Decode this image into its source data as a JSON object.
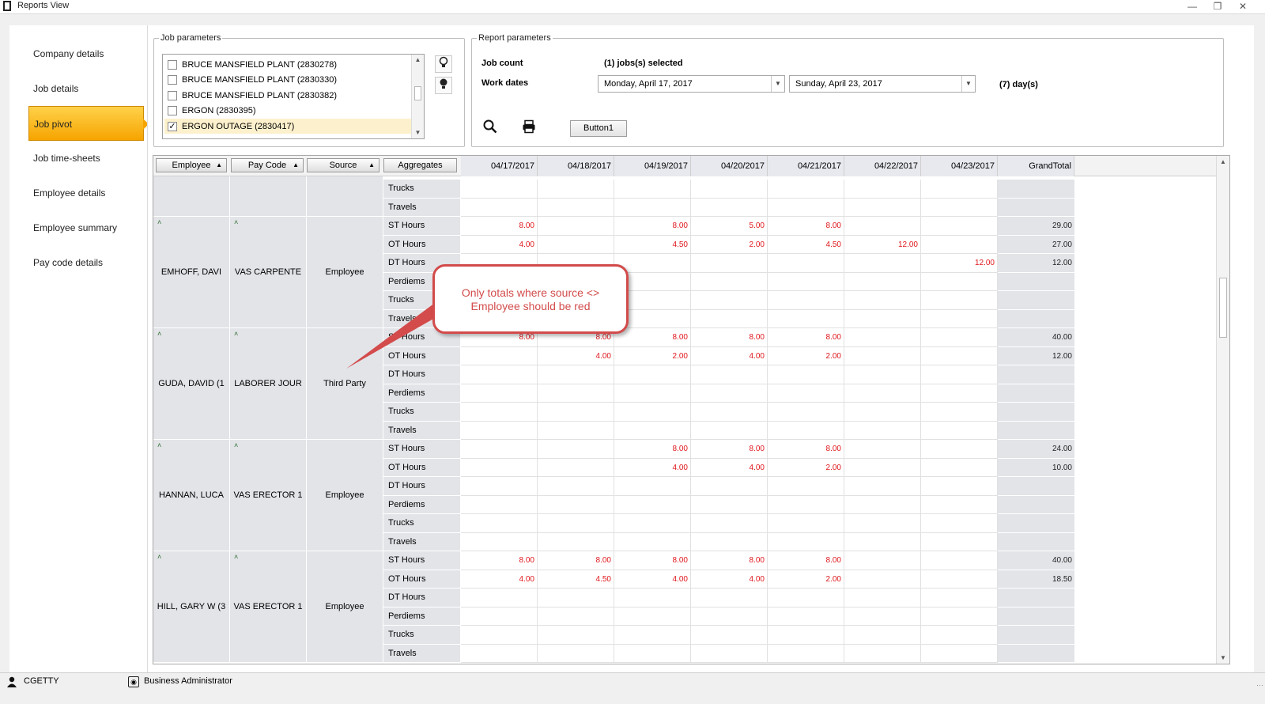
{
  "window": {
    "title": "Reports View"
  },
  "sidebar": {
    "items": [
      {
        "label": "Company details"
      },
      {
        "label": "Job details"
      },
      {
        "label": "Job pivot",
        "active": true
      },
      {
        "label": "Job time-sheets"
      },
      {
        "label": "Employee details"
      },
      {
        "label": "Employee summary"
      },
      {
        "label": "Pay code details"
      }
    ]
  },
  "job_parameters": {
    "legend": "Job parameters",
    "jobs": [
      {
        "label": "BRUCE MANSFIELD PLANT (2830278)",
        "checked": false
      },
      {
        "label": "BRUCE MANSFIELD PLANT (2830330)",
        "checked": false
      },
      {
        "label": "BRUCE MANSFIELD PLANT (2830382)",
        "checked": false
      },
      {
        "label": "ERGON (2830395)",
        "checked": false
      },
      {
        "label": "ERGON OUTAGE (2830417)",
        "checked": true
      }
    ]
  },
  "report_parameters": {
    "legend": "Report parameters",
    "job_count_label": "Job count",
    "job_count_value": "(1) jobs(s) selected",
    "work_dates_label": "Work dates",
    "start_date": "Monday, April 17, 2017",
    "end_date": "Sunday, April 23, 2017",
    "days": "(7) day(s)",
    "button1_label": "Button1"
  },
  "pivot": {
    "field_buttons": [
      "Employee",
      "Pay Code",
      "Source",
      "Aggregates"
    ],
    "dates": [
      "04/17/2017",
      "04/18/2017",
      "04/19/2017",
      "04/20/2017",
      "04/21/2017",
      "04/22/2017",
      "04/23/2017"
    ],
    "grand_total_label": "GrandTotal",
    "partial_rows": [
      {
        "agg": "Trucks",
        "total": ""
      },
      {
        "agg": "Travels",
        "total": ""
      }
    ],
    "groups": [
      {
        "employee": "EMHOFF, DAVI",
        "pay_code": "VAS CARPENTE",
        "source": "Employee",
        "rows": [
          {
            "agg": "ST Hours",
            "values": [
              "8.00",
              "",
              "8.00",
              "5.00",
              "8.00",
              "",
              ""
            ],
            "total": "29.00"
          },
          {
            "agg": "OT Hours",
            "values": [
              "4.00",
              "",
              "4.50",
              "2.00",
              "4.50",
              "12.00",
              ""
            ],
            "total": "27.00"
          },
          {
            "agg": "DT Hours",
            "values": [
              "",
              "",
              "",
              "",
              "",
              "",
              "12.00"
            ],
            "total": "12.00"
          },
          {
            "agg": "Perdiems",
            "values": [
              "",
              "",
              "",
              "",
              "",
              "",
              ""
            ],
            "total": ""
          },
          {
            "agg": "Trucks",
            "values": [
              "",
              "",
              "",
              "",
              "",
              "",
              ""
            ],
            "total": ""
          },
          {
            "agg": "Travels",
            "values": [
              "",
              "",
              "",
              "",
              "",
              "",
              ""
            ],
            "total": ""
          }
        ]
      },
      {
        "employee": "GUDA, DAVID (1",
        "pay_code": "LABORER JOUR",
        "source": "Third Party",
        "rows": [
          {
            "agg": "ST Hours",
            "values": [
              "8.00",
              "8.00",
              "8.00",
              "8.00",
              "8.00",
              "",
              ""
            ],
            "total": "40.00"
          },
          {
            "agg": "OT Hours",
            "values": [
              "",
              "4.00",
              "2.00",
              "4.00",
              "2.00",
              "",
              ""
            ],
            "total": "12.00"
          },
          {
            "agg": "DT Hours",
            "values": [
              "",
              "",
              "",
              "",
              "",
              "",
              ""
            ],
            "total": ""
          },
          {
            "agg": "Perdiems",
            "values": [
              "",
              "",
              "",
              "",
              "",
              "",
              ""
            ],
            "total": ""
          },
          {
            "agg": "Trucks",
            "values": [
              "",
              "",
              "",
              "",
              "",
              "",
              ""
            ],
            "total": ""
          },
          {
            "agg": "Travels",
            "values": [
              "",
              "",
              "",
              "",
              "",
              "",
              ""
            ],
            "total": ""
          }
        ]
      },
      {
        "employee": "HANNAN, LUCA",
        "pay_code": "VAS ERECTOR 1",
        "source": "Employee",
        "rows": [
          {
            "agg": "ST Hours",
            "values": [
              "",
              "",
              "8.00",
              "8.00",
              "8.00",
              "",
              ""
            ],
            "total": "24.00"
          },
          {
            "agg": "OT Hours",
            "values": [
              "",
              "",
              "4.00",
              "4.00",
              "2.00",
              "",
              ""
            ],
            "total": "10.00"
          },
          {
            "agg": "DT Hours",
            "values": [
              "",
              "",
              "",
              "",
              "",
              "",
              ""
            ],
            "total": ""
          },
          {
            "agg": "Perdiems",
            "values": [
              "",
              "",
              "",
              "",
              "",
              "",
              ""
            ],
            "total": ""
          },
          {
            "agg": "Trucks",
            "values": [
              "",
              "",
              "",
              "",
              "",
              "",
              ""
            ],
            "total": ""
          },
          {
            "agg": "Travels",
            "values": [
              "",
              "",
              "",
              "",
              "",
              "",
              ""
            ],
            "total": ""
          }
        ]
      },
      {
        "employee": "HILL, GARY W (3",
        "pay_code": "VAS ERECTOR 1",
        "source": "Employee",
        "rows": [
          {
            "agg": "ST Hours",
            "values": [
              "8.00",
              "8.00",
              "8.00",
              "8.00",
              "8.00",
              "",
              ""
            ],
            "total": "40.00"
          },
          {
            "agg": "OT Hours",
            "values": [
              "4.00",
              "4.50",
              "4.00",
              "4.00",
              "2.00",
              "",
              ""
            ],
            "total": "18.50"
          },
          {
            "agg": "DT Hours",
            "values": [
              "",
              "",
              "",
              "",
              "",
              "",
              ""
            ],
            "total": ""
          },
          {
            "agg": "Perdiems",
            "values": [
              "",
              "",
              "",
              "",
              "",
              "",
              ""
            ],
            "total": ""
          },
          {
            "agg": "Trucks",
            "values": [
              "",
              "",
              "",
              "",
              "",
              "",
              ""
            ],
            "total": ""
          },
          {
            "agg": "Travels",
            "values": [
              "",
              "",
              "",
              "",
              "",
              "",
              ""
            ],
            "total": ""
          }
        ]
      }
    ]
  },
  "annotation": {
    "text": "Only totals where source <> Employee should be red"
  },
  "status": {
    "user": "CGETTY",
    "role": "Business Administrator"
  },
  "colors": {
    "accent": "#f6a400",
    "value_red": "#e0181d",
    "callout": "#d34b4b"
  }
}
